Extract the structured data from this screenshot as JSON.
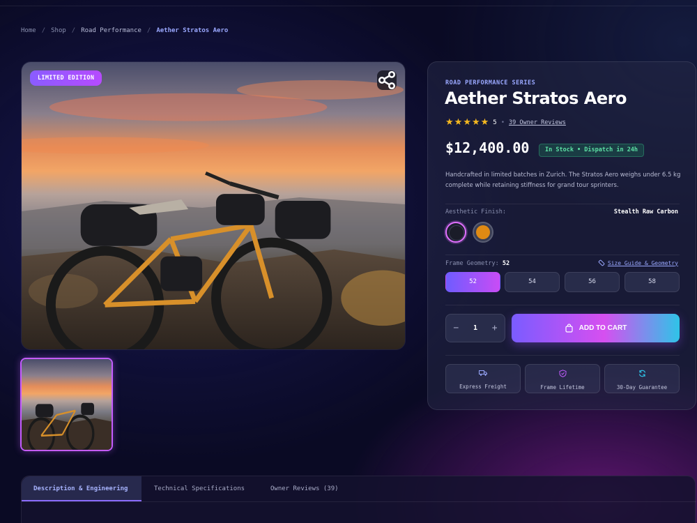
{
  "breadcrumb": {
    "items": [
      "Home",
      "Shop",
      "Road Performance"
    ],
    "current": "Aether Stratos Aero",
    "separator": "/"
  },
  "gallery": {
    "badge": "LIMITED EDITION",
    "share_icon": "share-icon",
    "images": [
      {
        "alt": "bicycle-at-sunset",
        "selected": true
      }
    ]
  },
  "product": {
    "series": "ROAD PERFORMANCE SERIES",
    "title": "Aether Stratos Aero",
    "rating": "5",
    "rating_stars": 5,
    "reviews_link": "39 Owner Reviews",
    "price": "$12,400.00",
    "stock_status": "In Stock • Dispatch in 24h",
    "description": "Handcrafted in limited batches in Zurich. The Stratos Aero weighs under 6.5 kg complete while retaining stiffness for grand tour sprinters."
  },
  "finish": {
    "label": "Aesthetic Finish:",
    "selected_name": "Stealth Raw Carbon",
    "swatches": [
      {
        "color": "#1a1c28",
        "selected": true
      },
      {
        "color": "#e08a14",
        "selected": false
      }
    ]
  },
  "geometry": {
    "label": "Frame Geometry:",
    "selected": "52",
    "guide_link": "Size Guide & Geometry",
    "sizes": [
      "52",
      "54",
      "56",
      "58"
    ]
  },
  "purchase": {
    "quantity": "1",
    "minus": "−",
    "plus": "+",
    "add_to_cart": "ADD TO CART"
  },
  "features": [
    {
      "label": "Express Freight",
      "icon": "truck-icon",
      "color": "#9aa8ff"
    },
    {
      "label": "Frame Lifetime",
      "icon": "shield-icon",
      "color": "#c35cff"
    },
    {
      "label": "30-Day Guarantee",
      "icon": "refresh-icon",
      "color": "#2fc4e8"
    }
  ],
  "tabs": {
    "items": [
      "Description & Engineering",
      "Technical Specifications",
      "Owner Reviews (39)"
    ],
    "active_index": 0
  },
  "colors": {
    "accent": "#8a6cff",
    "brand_pink": "#d64ff0",
    "brand_cyan": "#2fc4e8",
    "star": "#f5b820",
    "stock_green": "#5de0a4"
  }
}
